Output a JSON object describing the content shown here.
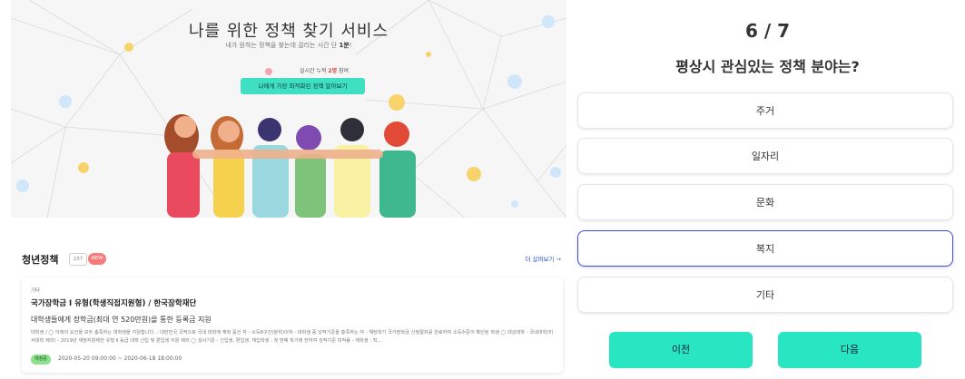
{
  "left_panel": {
    "hero": {
      "title": "나를 위한 정책 찾기 서비스",
      "subtitle_prefix": "내가 원하는 정책을 찾는데 걸리는 시간 단 ",
      "subtitle_highlight": "1분",
      "subtitle_suffix": "!",
      "live_prefix": "실시간 누적 ",
      "live_count": "2명",
      "live_suffix": " 참여",
      "cta_button": "나에게 가장 최적화된 정책 알아보기"
    },
    "section": {
      "title": "청년정책",
      "count": "237",
      "new_badge": "NEW",
      "more_link": "더 살펴보기 →"
    },
    "policy_card": {
      "category": "기타",
      "title": "국가장학금 Ⅰ 유형(학생직접지원형) / 한국장학재단",
      "summary": "대학생들에게 장학금(최대 연 520만원)을 통한 등록금 지원",
      "description": "대학생 / ◯ 아래의 요건을 모두 충족하는 대학생을 지원합니다. - 대한민국 국적으로 국내 대학에 재학 중인 자 - 소득8구간(분위)이하 - 대학생 중 성적기준을 충족하는 자 - 해당학기 국가장학금 신청절차를 완료하여 소득수준이 확인된 학생 ◯ 대상대학 - 국내대학(미서대학 제외) - 2019년 재정지원제한 유형 Ⅱ 등급 대학 신입 및 편입생 지원 제외 ◯ 성시기준 - 신입생, 편입생, 재입학생 : 첫 번째 학기에 한하여 성적기준 미적용 - 재학생 : 직...",
      "status": "예정중",
      "period": "2020-05-20 09:00:00 ~ 2020-06-18 18:00:00"
    }
  },
  "right_panel": {
    "step": "6 / 7",
    "question": "평상시 관심있는 정책 분야는?",
    "options": [
      {
        "label": "주거",
        "selected": false
      },
      {
        "label": "일자리",
        "selected": false
      },
      {
        "label": "문화",
        "selected": false
      },
      {
        "label": "복지",
        "selected": true
      },
      {
        "label": "기타",
        "selected": false
      }
    ],
    "prev_button": "이전",
    "next_button": "다음"
  },
  "colors": {
    "accent": "#27e6c1",
    "selected_border": "#3f4fd1",
    "new_badge": "#f47c7c",
    "link": "#2a58c8"
  }
}
